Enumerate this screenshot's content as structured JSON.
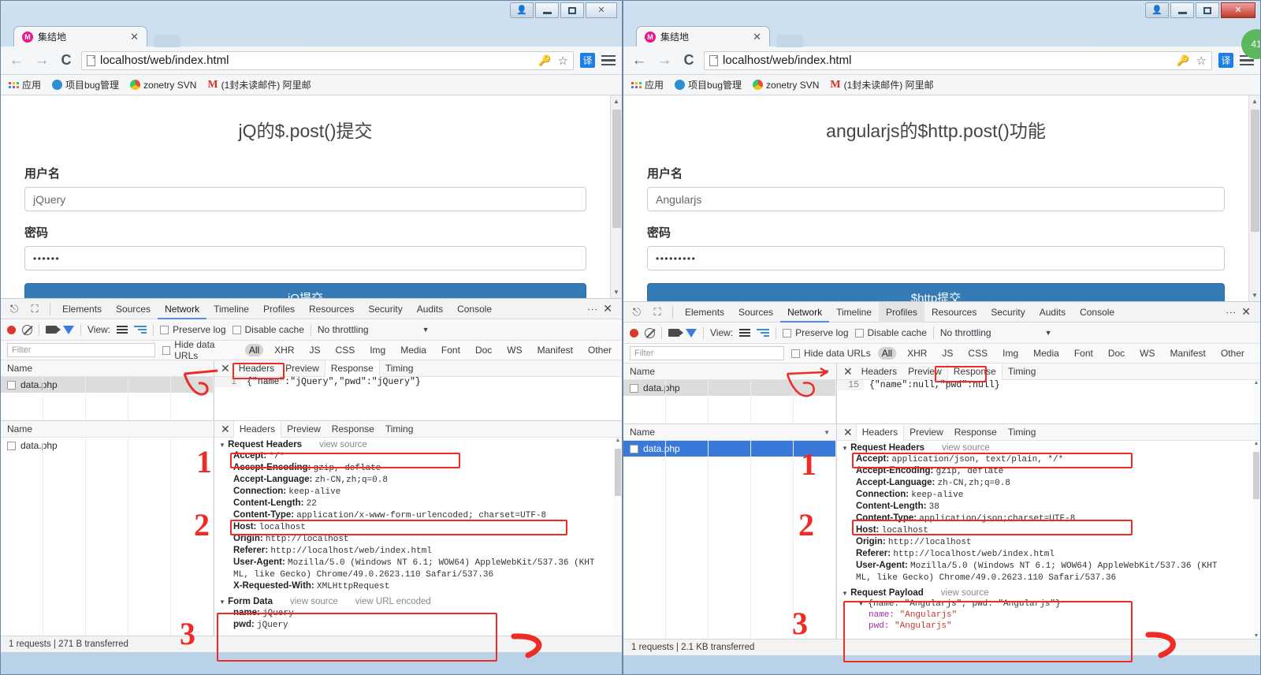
{
  "windows": [
    {
      "id": "left",
      "tab": {
        "title": "集结地",
        "favicon_letter": "M",
        "close_label": "✕"
      },
      "toolbar": {
        "back": "←",
        "forward": "→",
        "reload": "C",
        "url": "localhost/web/index.html",
        "key_icon": "key-icon",
        "star_icon": "☆",
        "translate_label": "译"
      },
      "bookmarks": [
        {
          "label": "应用",
          "icon": "apps-grid-icon"
        },
        {
          "label": "项目bug管理",
          "icon": "blue-dot-icon"
        },
        {
          "label": "zonetry SVN",
          "icon": "chrome-dot-icon"
        },
        {
          "label": "(1封未读邮件) 阿里邮",
          "icon": "gmail-m-icon"
        }
      ],
      "page": {
        "title": "jQ的$.post()提交",
        "username_label": "用户名",
        "username_value": "jQuery",
        "password_label": "密码",
        "password_value": "••••••",
        "submit_label": "jQ提交"
      },
      "devtools": {
        "tabs": [
          "Elements",
          "Sources",
          "Network",
          "Timeline",
          "Profiles",
          "Resources",
          "Security",
          "Audits",
          "Console"
        ],
        "selected_tab": "Network",
        "hovered_tab": "",
        "close_label": "✕",
        "controls": {
          "view_label": "View:",
          "preserve_log": "Preserve log",
          "disable_cache": "Disable cache",
          "throttling": "No throttling"
        },
        "filter": {
          "placeholder": "Filter",
          "hide_data_urls": "Hide data URLs",
          "types": [
            "All",
            "XHR",
            "JS",
            "CSS",
            "Img",
            "Media",
            "Font",
            "Doc",
            "WS",
            "Manifest",
            "Other"
          ],
          "active_type": "All"
        },
        "name_column_header": "Name",
        "request_name": "data.php",
        "detail_tabs": [
          "Headers",
          "Preview",
          "Response",
          "Timing"
        ],
        "top_selected_detail_tab": "Response",
        "bottom_selected_detail_tab": "Headers",
        "response_line_number": "1",
        "response_body": "{\"name\":\"jQuery\",\"pwd\":\"jQuery\"}",
        "request_headers_title": "Request Headers",
        "view_source_label": "view source",
        "headers": [
          {
            "name": "Accept:",
            "value": "*/*",
            "highlight": true
          },
          {
            "name": "Accept-Encoding:",
            "value": "gzip, deflate",
            "highlight": false
          },
          {
            "name": "Accept-Language:",
            "value": "zh-CN,zh;q=0.8",
            "highlight": false
          },
          {
            "name": "Connection:",
            "value": "keep-alive",
            "highlight": false
          },
          {
            "name": "Content-Length:",
            "value": "22",
            "highlight": false
          },
          {
            "name": "Content-Type:",
            "value": "application/x-www-form-urlencoded; charset=UTF-8",
            "highlight": true
          },
          {
            "name": "Host:",
            "value": "localhost",
            "highlight": false
          },
          {
            "name": "Origin:",
            "value": "http://localhost",
            "highlight": false
          },
          {
            "name": "Referer:",
            "value": "http://localhost/web/index.html",
            "highlight": false
          },
          {
            "name": "User-Agent:",
            "value": "Mozilla/5.0 (Windows NT 6.1; WOW64) AppleWebKit/537.36 (KHT",
            "highlight": false
          },
          {
            "name": "",
            "value": "ML, like Gecko) Chrome/49.0.2623.110 Safari/537.36",
            "highlight": false
          },
          {
            "name": "X-Requested-With:",
            "value": "XMLHttpRequest",
            "highlight": false
          }
        ],
        "payload_title": "Form Data",
        "payload_view_source": "view source",
        "payload_view_url_encoded": "view URL encoded",
        "payload_rows": [
          {
            "key": "name:",
            "value": "jQuery"
          },
          {
            "key": "pwd:",
            "value": "jQuery"
          }
        ],
        "status": "1 requests  |  271 B transferred"
      },
      "annotations": [
        "1",
        "2",
        "3",
        "5"
      ]
    },
    {
      "id": "right",
      "tab": {
        "title": "集结地",
        "favicon_letter": "M",
        "close_label": "✕"
      },
      "toolbar": {
        "back": "←",
        "forward": "→",
        "reload": "C",
        "url": "localhost/web/index.html",
        "key_icon": "key-icon",
        "star_icon": "☆",
        "translate_label": "译"
      },
      "bookmarks": [
        {
          "label": "应用",
          "icon": "apps-grid-icon"
        },
        {
          "label": "项目bug管理",
          "icon": "blue-dot-icon"
        },
        {
          "label": "zonetry SVN",
          "icon": "chrome-dot-icon"
        },
        {
          "label": "(1封未读邮件) 阿里邮",
          "icon": "gmail-m-icon"
        }
      ],
      "badge": "41",
      "page": {
        "title": "angularjs的$http.post()功能",
        "username_label": "用户名",
        "username_value": "Angularjs",
        "password_label": "密码",
        "password_value": "•••••••••",
        "submit_label": "$http提交"
      },
      "devtools": {
        "tabs": [
          "Elements",
          "Sources",
          "Network",
          "Timeline",
          "Profiles",
          "Resources",
          "Security",
          "Audits",
          "Console"
        ],
        "selected_tab": "Network",
        "hovered_tab": "Profiles",
        "close_label": "✕",
        "controls": {
          "view_label": "View:",
          "preserve_log": "Preserve log",
          "disable_cache": "Disable cache",
          "throttling": "No throttling"
        },
        "filter": {
          "placeholder": "Filter",
          "hide_data_urls": "Hide data URLs",
          "types": [
            "All",
            "XHR",
            "JS",
            "CSS",
            "Img",
            "Media",
            "Font",
            "Doc",
            "WS",
            "Manifest",
            "Other"
          ],
          "active_type": "All"
        },
        "name_column_header": "Name",
        "request_name": "data.php",
        "detail_tabs": [
          "Headers",
          "Preview",
          "Response",
          "Timing"
        ],
        "top_selected_detail_tab": "Response",
        "bottom_selected_detail_tab": "Headers",
        "response_line_number": "15",
        "response_body": "{\"name\":null,\"pwd\":null}",
        "request_headers_title": "Request Headers",
        "view_source_label": "view source",
        "headers": [
          {
            "name": "Accept:",
            "value": "application/json, text/plain, */*",
            "highlight": true
          },
          {
            "name": "Accept-Encoding:",
            "value": "gzip, deflate",
            "highlight": false
          },
          {
            "name": "Accept-Language:",
            "value": "zh-CN,zh;q=0.8",
            "highlight": false
          },
          {
            "name": "Connection:",
            "value": "keep-alive",
            "highlight": false
          },
          {
            "name": "Content-Length:",
            "value": "38",
            "highlight": false
          },
          {
            "name": "Content-Type:",
            "value": "application/json;charset=UTF-8",
            "highlight": true
          },
          {
            "name": "Host:",
            "value": "localhost",
            "highlight": false
          },
          {
            "name": "Origin:",
            "value": "http://localhost",
            "highlight": false
          },
          {
            "name": "Referer:",
            "value": "http://localhost/web/index.html",
            "highlight": false
          },
          {
            "name": "User-Agent:",
            "value": "Mozilla/5.0 (Windows NT 6.1; WOW64) AppleWebKit/537.36 (KHT",
            "highlight": false
          },
          {
            "name": "",
            "value": "ML, like Gecko) Chrome/49.0.2623.110 Safari/537.36",
            "highlight": false
          }
        ],
        "payload_title": "Request Payload",
        "payload_view_source": "view source",
        "payload_object_line": "{name: \"Angularjs\", pwd: \"Angularjs\"}",
        "payload_rows": [
          {
            "key": "name:",
            "value": "\"Angularjs\""
          },
          {
            "key": "pwd:",
            "value": "\"Angularjs\""
          }
        ],
        "status": "1 requests  |  2.1 KB transferred"
      },
      "annotations": [
        "1",
        "2",
        "3",
        "5"
      ]
    }
  ],
  "colors": {
    "annotation_red": "#ee2b24",
    "submit_blue": "#337ab7",
    "selection_blue": "#3879d9",
    "translate_blue": "#1e7ee8",
    "badge_green": "#5cb85c"
  }
}
